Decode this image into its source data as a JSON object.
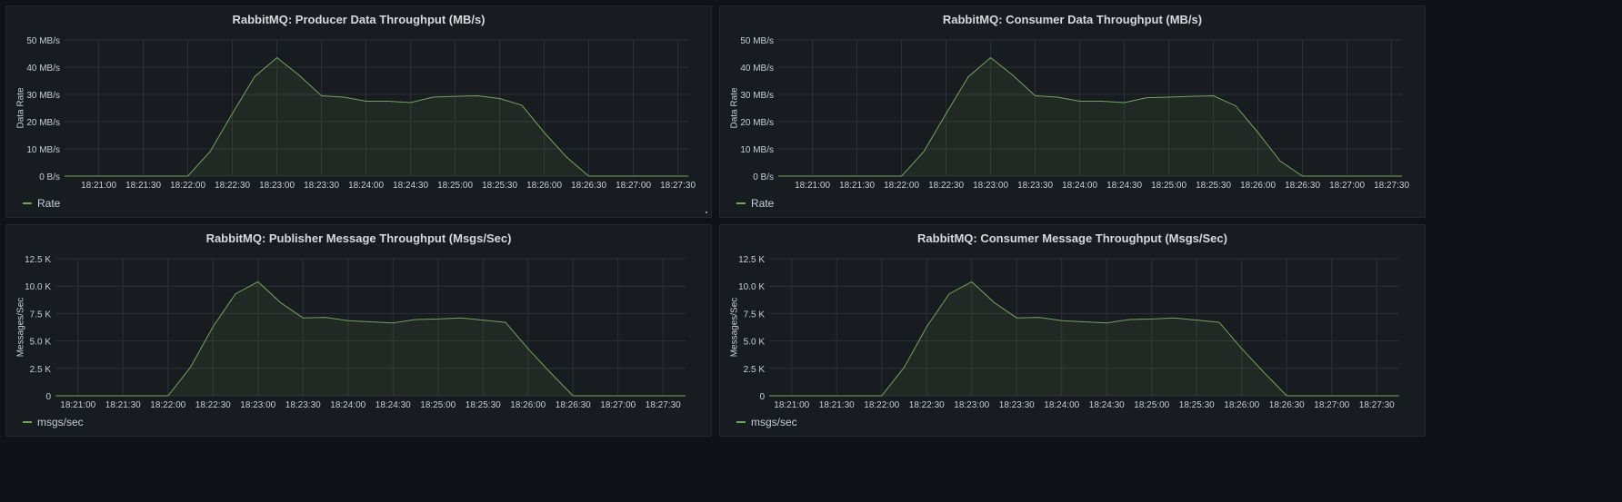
{
  "theme": {
    "series_color": "#73a45d",
    "grid_color": "#2c3235",
    "axis_text_color": "#c7d0d9",
    "panel_bg": "#181b1f",
    "page_bg": "#111217"
  },
  "panels": [
    {
      "title": "RabbitMQ: Producer Data Throughput (MB/s)",
      "legend": "Rate"
    },
    {
      "title": "RabbitMQ: Consumer Data Throughput (MB/s)",
      "legend": "Rate"
    },
    {
      "title": "RabbitMQ: Publisher Message Throughput (Msgs/Sec)",
      "legend": "msgs/sec"
    },
    {
      "title": "RabbitMQ: Consumer Message Throughput (Msgs/Sec)",
      "legend": "msgs/sec"
    }
  ],
  "chart_data": [
    {
      "type": "area",
      "title": "RabbitMQ: Producer Data Throughput (MB/s)",
      "ylabel": "Data Rate",
      "ylim": [
        0,
        50
      ],
      "ytick_values": [
        0,
        10,
        20,
        30,
        40,
        50
      ],
      "ytick_labels": [
        "0 B/s",
        "10 MB/s",
        "20 MB/s",
        "30 MB/s",
        "40 MB/s",
        "50 MB/s"
      ],
      "xlim": [
        "18:20:37",
        "18:27:37"
      ],
      "xticks": [
        "18:21:00",
        "18:21:30",
        "18:22:00",
        "18:22:30",
        "18:23:00",
        "18:23:30",
        "18:24:00",
        "18:24:30",
        "18:25:00",
        "18:25:30",
        "18:26:00",
        "18:26:30",
        "18:27:00",
        "18:27:30"
      ],
      "grid": true,
      "series": [
        {
          "name": "Rate",
          "x": [
            "18:20:37",
            "18:21:00",
            "18:21:30",
            "18:22:00",
            "18:22:15",
            "18:22:30",
            "18:22:45",
            "18:23:00",
            "18:23:15",
            "18:23:30",
            "18:23:45",
            "18:24:00",
            "18:24:15",
            "18:24:30",
            "18:24:45",
            "18:25:00",
            "18:25:15",
            "18:25:30",
            "18:25:45",
            "18:26:00",
            "18:26:15",
            "18:26:30",
            "18:27:00",
            "18:27:37"
          ],
          "values": [
            0,
            0,
            0,
            0,
            9,
            23,
            36.5,
            43.5,
            37,
            29.5,
            29,
            27.5,
            27.5,
            27,
            29,
            29.3,
            29.5,
            28.5,
            26,
            16,
            7,
            0,
            0,
            0
          ]
        }
      ]
    },
    {
      "type": "area",
      "title": "RabbitMQ: Consumer Data Throughput (MB/s)",
      "ylabel": "Data Rate",
      "ylim": [
        0,
        50
      ],
      "ytick_values": [
        0,
        10,
        20,
        30,
        40,
        50
      ],
      "ytick_labels": [
        "0 B/s",
        "10 MB/s",
        "20 MB/s",
        "30 MB/s",
        "40 MB/s",
        "50 MB/s"
      ],
      "xlim": [
        "18:20:37",
        "18:27:37"
      ],
      "xticks": [
        "18:21:00",
        "18:21:30",
        "18:22:00",
        "18:22:30",
        "18:23:00",
        "18:23:30",
        "18:24:00",
        "18:24:30",
        "18:25:00",
        "18:25:30",
        "18:26:00",
        "18:26:30",
        "18:27:00",
        "18:27:30"
      ],
      "grid": true,
      "series": [
        {
          "name": "Rate",
          "x": [
            "18:20:37",
            "18:21:00",
            "18:21:30",
            "18:22:00",
            "18:22:15",
            "18:22:30",
            "18:22:45",
            "18:23:00",
            "18:23:15",
            "18:23:30",
            "18:23:45",
            "18:24:00",
            "18:24:15",
            "18:24:30",
            "18:24:45",
            "18:25:00",
            "18:25:15",
            "18:25:30",
            "18:25:45",
            "18:26:00",
            "18:26:15",
            "18:26:30",
            "18:27:00",
            "18:27:37"
          ],
          "values": [
            0,
            0,
            0,
            0,
            9,
            23,
            36.5,
            43.5,
            37,
            29.5,
            29,
            27.5,
            27.5,
            27,
            28.8,
            29,
            29.3,
            29.5,
            25.8,
            16,
            5.5,
            0,
            0,
            0
          ]
        }
      ]
    },
    {
      "type": "area",
      "title": "RabbitMQ: Publisher Message Throughput (Msgs/Sec)",
      "ylabel": "Messages/Sec",
      "ylim": [
        0,
        12500
      ],
      "ytick_values": [
        0,
        2500,
        5000,
        7500,
        10000,
        12500
      ],
      "ytick_labels": [
        "0",
        "2.5 K",
        "5.0 K",
        "7.5 K",
        "10.0 K",
        "12.5 K"
      ],
      "xlim": [
        "18:20:45",
        "18:27:45"
      ],
      "xticks": [
        "18:21:00",
        "18:21:30",
        "18:22:00",
        "18:22:30",
        "18:23:00",
        "18:23:30",
        "18:24:00",
        "18:24:30",
        "18:25:00",
        "18:25:30",
        "18:26:00",
        "18:26:30",
        "18:27:00",
        "18:27:30"
      ],
      "grid": true,
      "series": [
        {
          "name": "msgs/sec",
          "x": [
            "18:20:45",
            "18:21:00",
            "18:21:30",
            "18:22:00",
            "18:22:15",
            "18:22:30",
            "18:22:45",
            "18:23:00",
            "18:23:15",
            "18:23:30",
            "18:23:45",
            "18:24:00",
            "18:24:15",
            "18:24:30",
            "18:24:45",
            "18:25:00",
            "18:25:15",
            "18:25:30",
            "18:25:45",
            "18:26:00",
            "18:26:15",
            "18:26:30",
            "18:27:00",
            "18:27:45"
          ],
          "values": [
            0,
            0,
            0,
            0,
            2600,
            6300,
            9300,
            10400,
            8500,
            7100,
            7150,
            6850,
            6750,
            6650,
            6950,
            7000,
            7100,
            6900,
            6700,
            4300,
            2100,
            0,
            0,
            0
          ]
        }
      ]
    },
    {
      "type": "area",
      "title": "RabbitMQ: Consumer Message Throughput (Msgs/Sec)",
      "ylabel": "Messages/Sec",
      "ylim": [
        0,
        12500
      ],
      "ytick_values": [
        0,
        2500,
        5000,
        7500,
        10000,
        12500
      ],
      "ytick_labels": [
        "0",
        "2.5 K",
        "5.0 K",
        "7.5 K",
        "10.0 K",
        "12.5 K"
      ],
      "xlim": [
        "18:20:45",
        "18:27:45"
      ],
      "xticks": [
        "18:21:00",
        "18:21:30",
        "18:22:00",
        "18:22:30",
        "18:23:00",
        "18:23:30",
        "18:24:00",
        "18:24:30",
        "18:25:00",
        "18:25:30",
        "18:26:00",
        "18:26:30",
        "18:27:00",
        "18:27:30"
      ],
      "grid": true,
      "series": [
        {
          "name": "msgs/sec",
          "x": [
            "18:20:45",
            "18:21:00",
            "18:21:30",
            "18:22:00",
            "18:22:15",
            "18:22:30",
            "18:22:45",
            "18:23:00",
            "18:23:15",
            "18:23:30",
            "18:23:45",
            "18:24:00",
            "18:24:15",
            "18:24:30",
            "18:24:45",
            "18:25:00",
            "18:25:15",
            "18:25:30",
            "18:25:45",
            "18:26:00",
            "18:26:15",
            "18:26:30",
            "18:27:00",
            "18:27:45"
          ],
          "values": [
            0,
            0,
            0,
            0,
            2600,
            6300,
            9300,
            10400,
            8500,
            7100,
            7150,
            6850,
            6750,
            6650,
            6950,
            7000,
            7100,
            6900,
            6700,
            4300,
            2100,
            0,
            0,
            0
          ]
        }
      ]
    }
  ]
}
